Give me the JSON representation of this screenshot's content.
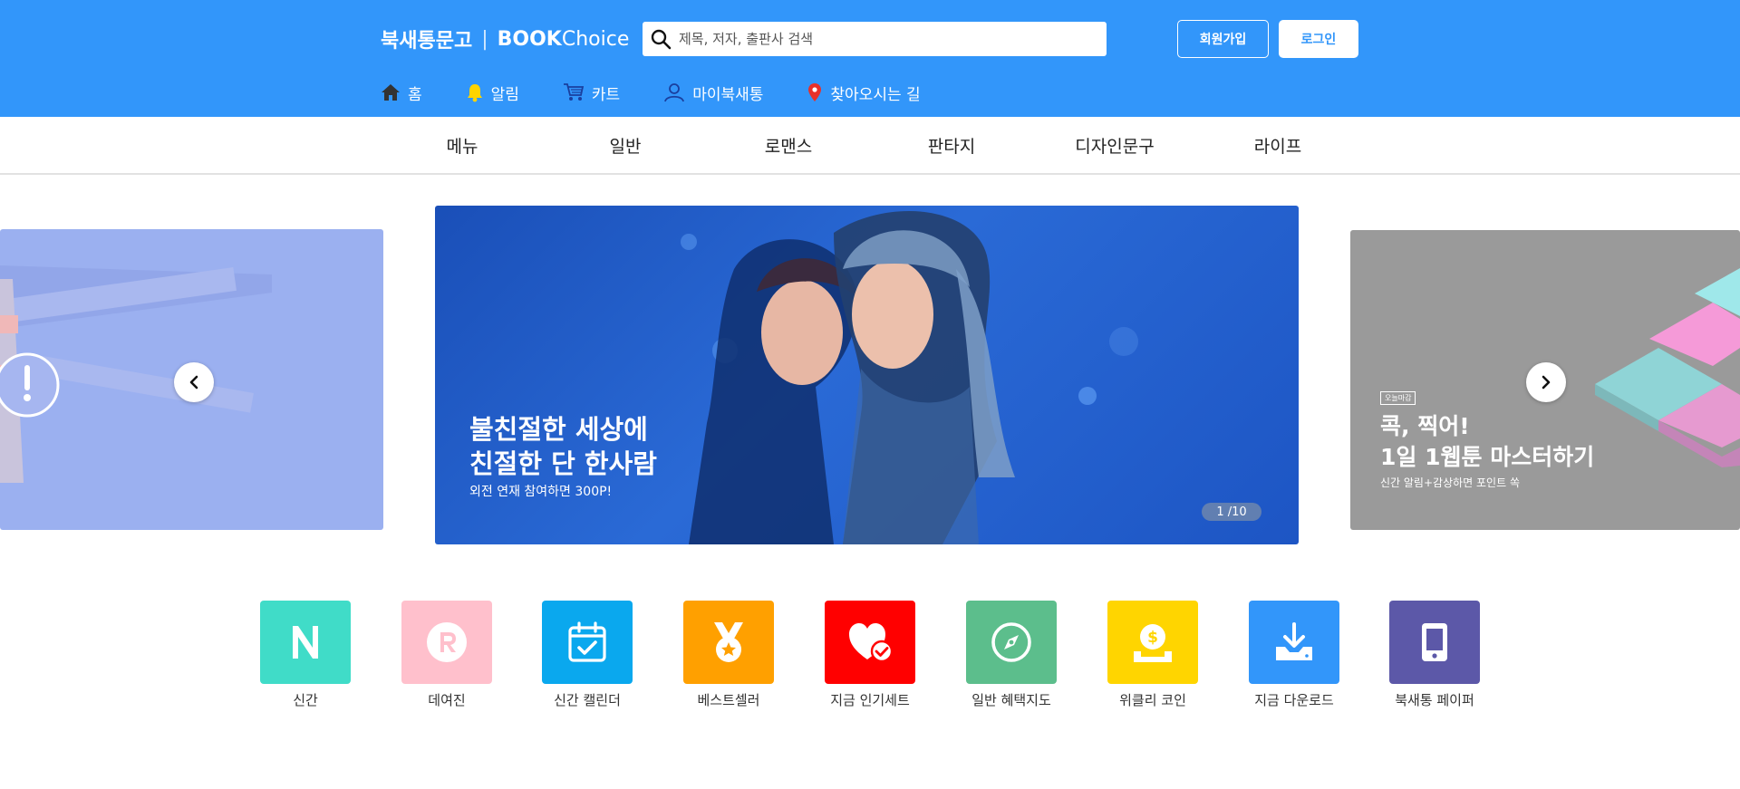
{
  "header": {
    "logo_ko": "북새통문고",
    "logo_sep": "|",
    "logo_en_bold": "BOOK",
    "logo_en": "Choice",
    "search_placeholder": "제목, 저자, 출판사 검색",
    "search_icon": "search-icon",
    "join_label": "회원가입",
    "login_label": "로그인",
    "nav": [
      {
        "label": "홈",
        "icon": "home-icon",
        "icon_color": "#333333"
      },
      {
        "label": "알림",
        "icon": "bell-icon",
        "icon_color": "#ffd400"
      },
      {
        "label": "카트",
        "icon": "cart-icon",
        "icon_color": "#1a3f9e"
      },
      {
        "label": "마이북새통",
        "icon": "user-icon",
        "icon_color": "#1a3f9e"
      },
      {
        "label": "찾아오시는 길",
        "icon": "location-pin-icon",
        "icon_color": "#e8302a"
      }
    ]
  },
  "categories": [
    "메뉴",
    "일반",
    "로맨스",
    "판타지",
    "디자인문구",
    "라이프"
  ],
  "carousel": {
    "center": {
      "title_line1": "불친절한 세상에",
      "title_line2": "친절한 단 한사람",
      "subtitle": "외전 연재 참여하면 300P!",
      "pager": "1 /10"
    },
    "right": {
      "badge": "오늘마감",
      "title_line1": "콕, 찍어!",
      "title_line2": "1일 1웹툰 마스터하기",
      "subtitle": "신간 알림+감상하면 포인트 쏙"
    }
  },
  "quick_menu": [
    {
      "label": "신간",
      "icon": "n-letter-icon",
      "color": "#40dcc8"
    },
    {
      "label": "데여진",
      "icon": "r-circle-icon",
      "color": "#ffc0cc"
    },
    {
      "label": "신간 캘린더",
      "icon": "calendar-check-icon",
      "color": "#0aa8ee"
    },
    {
      "label": "베스트셀러",
      "icon": "medal-icon",
      "color": "#ffa000"
    },
    {
      "label": "지금 인기세트",
      "icon": "heart-check-icon",
      "color": "#ff0000"
    },
    {
      "label": "일반 혜택지도",
      "icon": "compass-icon",
      "color": "#5cbe8c"
    },
    {
      "label": "위클리 코인",
      "icon": "coin-icon",
      "color": "#ffd500"
    },
    {
      "label": "지금 다운로드",
      "icon": "download-icon",
      "color": "#3296fa"
    },
    {
      "label": "북새통 페이퍼",
      "icon": "tablet-icon",
      "color": "#5c58a8"
    }
  ]
}
